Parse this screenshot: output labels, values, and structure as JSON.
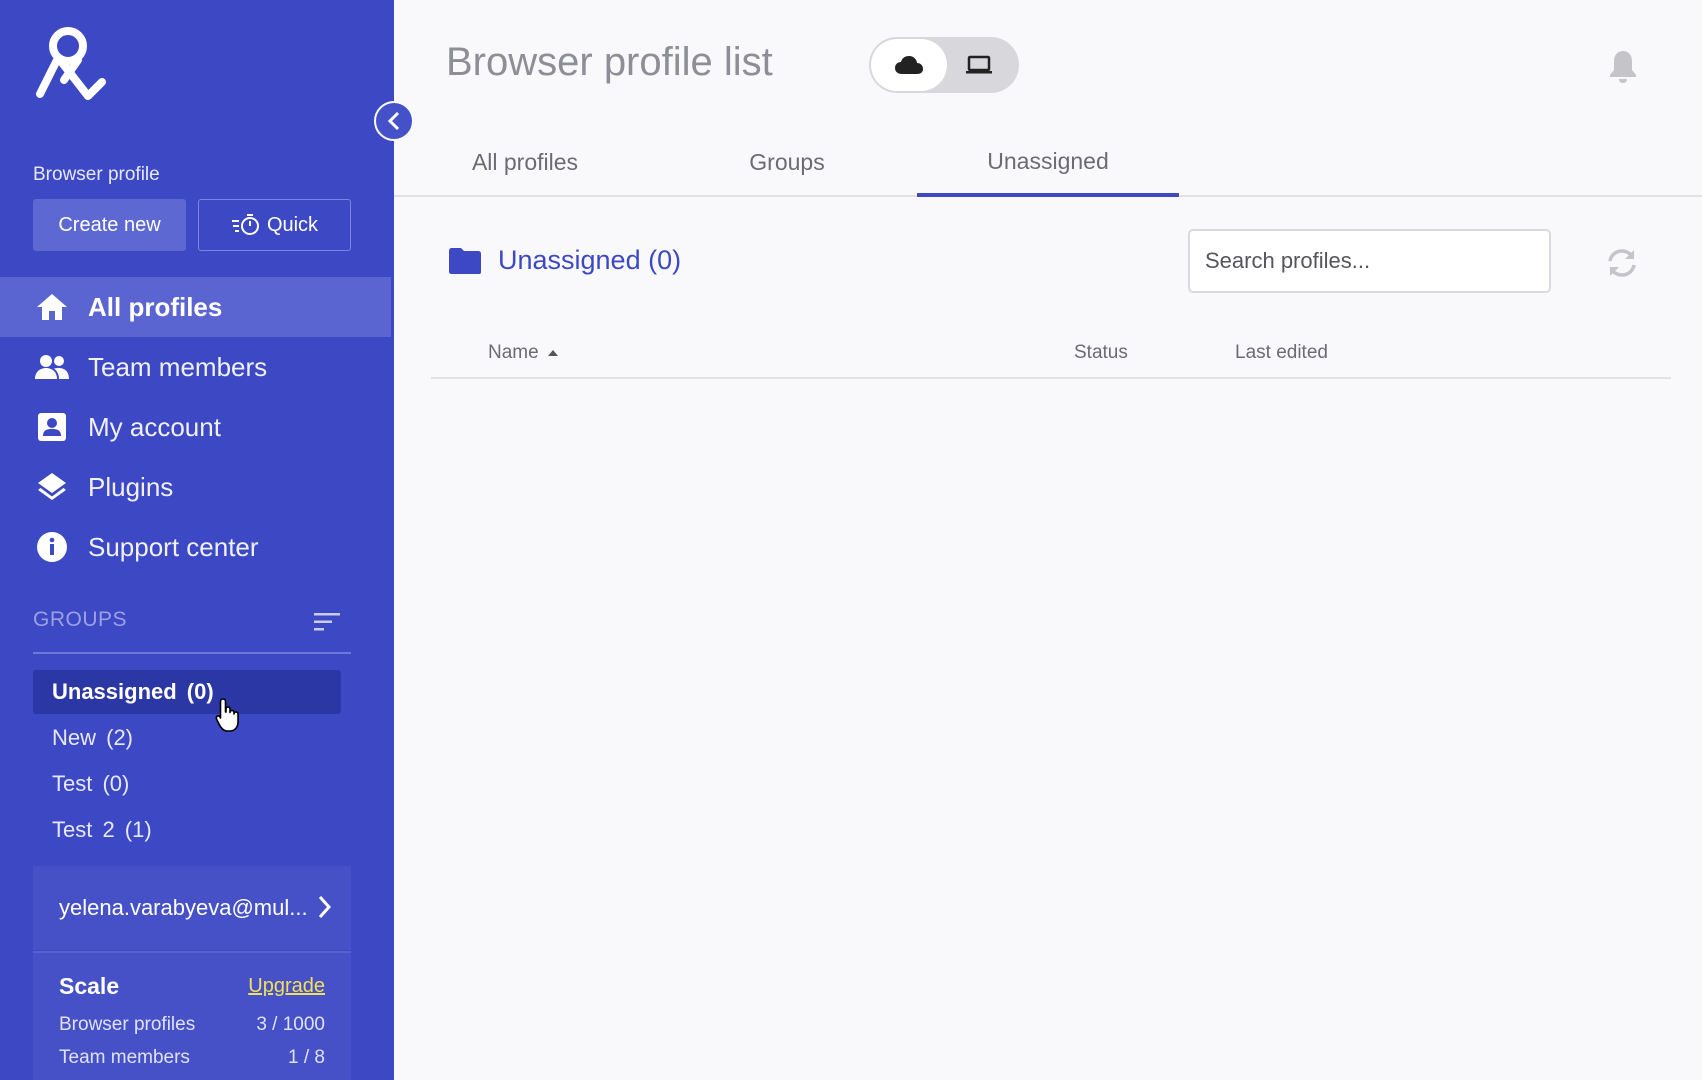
{
  "sidebar": {
    "section_label": "Browser profile",
    "create_new_label": "Create new",
    "quick_label": "Quick",
    "nav": [
      {
        "label": "All profiles",
        "icon": "home-icon",
        "active": true
      },
      {
        "label": "Team members",
        "icon": "people-icon"
      },
      {
        "label": "My account",
        "icon": "account-box-icon"
      },
      {
        "label": "Plugins",
        "icon": "layers-icon"
      },
      {
        "label": "Support center",
        "icon": "info-icon"
      }
    ],
    "groups_label": "GROUPS",
    "groups": [
      {
        "label": "Unassigned  (0)",
        "active": true
      },
      {
        "label": "New  (2)"
      },
      {
        "label": "Test  (0)"
      },
      {
        "label": "Test 2  (1)"
      }
    ],
    "account_email": "yelena.varabyeva@mul...",
    "plan": {
      "name": "Scale",
      "upgrade_label": "Upgrade",
      "rows": [
        {
          "label": "Browser profiles",
          "value": "3 / 1000"
        },
        {
          "label": "Team members",
          "value": "1 / 8"
        }
      ]
    }
  },
  "header": {
    "title": "Browser profile list"
  },
  "tabs": [
    {
      "label": "All profiles"
    },
    {
      "label": "Groups"
    },
    {
      "label": "Unassigned",
      "active": true
    }
  ],
  "content": {
    "folder_title": "Unassigned (0)",
    "search_placeholder": "Search profiles...",
    "columns": {
      "name": "Name",
      "status": "Status",
      "last_edited": "Last edited"
    }
  },
  "colors": {
    "sidebar_bg": "#3c48c4",
    "accent": "#3c48c4",
    "upgrade_link": "#f1e05a"
  }
}
